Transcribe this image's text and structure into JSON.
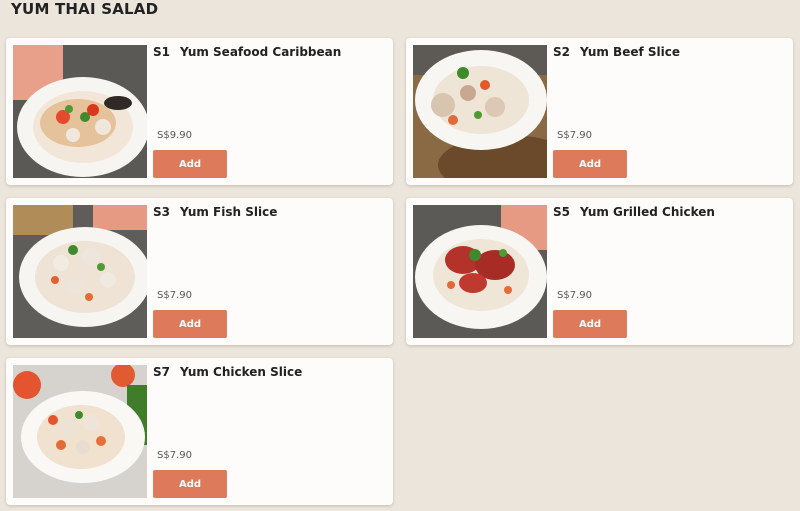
{
  "section": {
    "title": "YUM THAI SALAD"
  },
  "items": [
    {
      "code": "S1",
      "name": "Yum Seafood Caribbean",
      "price": "S$9.90",
      "add_label": "Add"
    },
    {
      "code": "S2",
      "name": "Yum Beef Slice",
      "price": "S$7.90",
      "add_label": "Add"
    },
    {
      "code": "S3",
      "name": "Yum Fish Slice",
      "price": "S$7.90",
      "add_label": "Add"
    },
    {
      "code": "S5",
      "name": "Yum Grilled Chicken",
      "price": "S$7.90",
      "add_label": "Add"
    },
    {
      "code": "S7",
      "name": "Yum Chicken Slice",
      "price": "S$7.90",
      "add_label": "Add"
    }
  ],
  "colors": {
    "page_background": "#ece5dc",
    "card_background": "#fdfcfb",
    "add_button": "#dd7a5b"
  }
}
